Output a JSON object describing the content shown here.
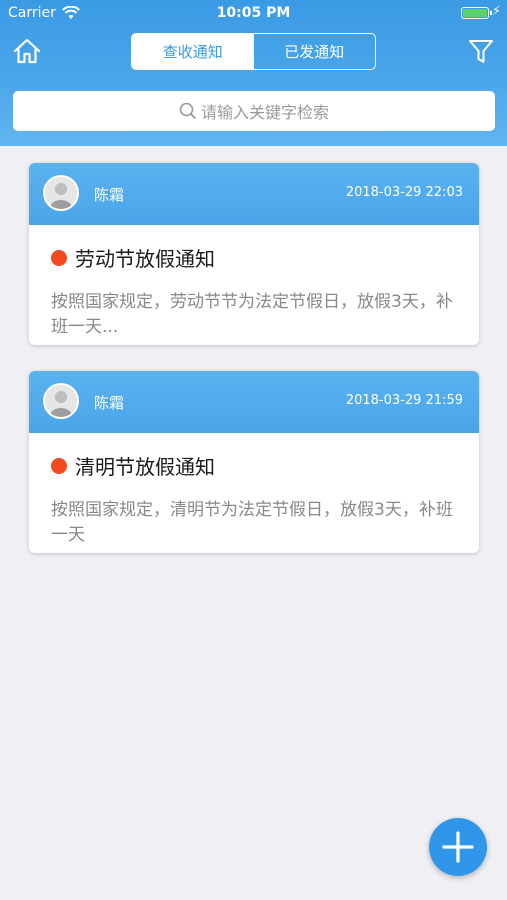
{
  "status_bar": {
    "carrier": "Carrier",
    "time": "10:05 PM",
    "icons": [
      "wifi-icon",
      "battery-icon",
      "charging-bolt-icon"
    ]
  },
  "header": {
    "tabs": [
      {
        "label": "查收通知",
        "active": true
      },
      {
        "label": "已发通知",
        "active": false
      }
    ],
    "left_icon": "home-icon",
    "right_icon": "filter-icon"
  },
  "search": {
    "placeholder": "请输入关键字检索",
    "icon": "search-icon"
  },
  "notices": [
    {
      "sender": "陈霜",
      "time": "2018-03-29 22:03",
      "title": "劳动节放假通知",
      "summary": "按照国家规定，劳动节节为法定节假日，放假3天，补班一天..."
    },
    {
      "sender": "陈霜",
      "time": "2018-03-29 21:59",
      "title": "清明节放假通知",
      "summary": "按照国家规定，清明节为法定节假日，放假3天，补班一天"
    }
  ],
  "fab": {
    "icon": "plus-icon"
  },
  "colors": {
    "header_blue": "#3a9ae4",
    "unread_dot": "#f24a1f",
    "fab_blue": "#2f96ea",
    "background": "#efeff4"
  }
}
